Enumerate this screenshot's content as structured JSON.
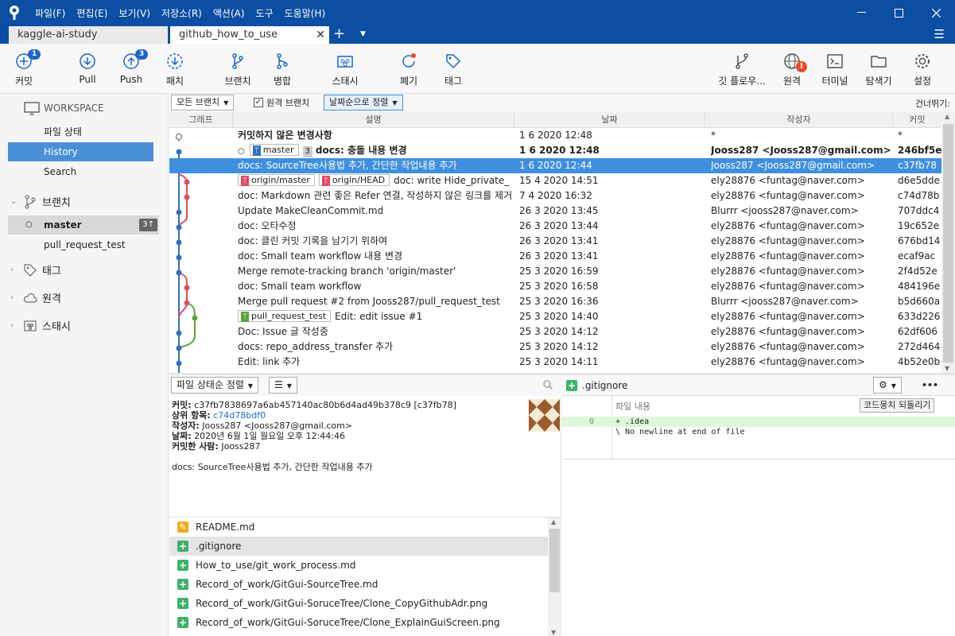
{
  "app": {
    "menus": [
      "파일(F)",
      "편집(E)",
      "보기(V)",
      "저장소(R)",
      "액션(A)",
      "도구",
      "도움말(H)"
    ]
  },
  "tabs": [
    {
      "label": "kaggle-ai-study"
    },
    {
      "label": "github_how_to_use",
      "close": "✕"
    }
  ],
  "tab_plus": "+",
  "toolbar": {
    "commit": {
      "label": "커밋",
      "badge": "1"
    },
    "pull": {
      "label": "Pull"
    },
    "push": {
      "label": "Push",
      "badge": "3"
    },
    "fetch": {
      "label": "패치"
    },
    "branch": {
      "label": "브랜치"
    },
    "merge": {
      "label": "병합"
    },
    "stash": {
      "label": "스태시"
    },
    "discard": {
      "label": "폐기"
    },
    "tag": {
      "label": "태그"
    },
    "gitflow": {
      "label": "깃 플로우..."
    },
    "remote": {
      "label": "원격",
      "alert": "!"
    },
    "terminal": {
      "label": "터미널"
    },
    "explorer": {
      "label": "탐색기"
    },
    "settings": {
      "label": "설정"
    }
  },
  "sidebar": {
    "workspace": "WORKSPACE",
    "items": [
      {
        "label": "파일 상태"
      },
      {
        "label": "History"
      },
      {
        "label": "Search"
      }
    ],
    "branches_title": "브랜치",
    "branches": [
      {
        "label": "master",
        "badge": "3↑"
      },
      {
        "label": "pull_request_test"
      }
    ],
    "tags_title": "태그",
    "remotes_title": "원격",
    "stashes_title": "스태시"
  },
  "filter": {
    "branches": "모든 브랜치",
    "remote_branches": "원격 브랜치",
    "sort": "날짜순으로 정렬",
    "jump": "건너뛰기:"
  },
  "columns": {
    "graph": "그래프",
    "desc": "설명",
    "date": "날짜",
    "author": "작성자",
    "commit": "커밋"
  },
  "commits": [
    {
      "desc": "커밋하지 않은 변경사항",
      "date": "1 6 2020 12:48",
      "author": "*",
      "hash": "*"
    },
    {
      "tag": "master",
      "count": "3",
      "desc": "docs: 충돌 내용 변경",
      "date": "1 6 2020 12:48",
      "author": "Jooss287 <Jooss287@gmail.com>",
      "hash": "246bf5e"
    },
    {
      "desc": "docs: SourceTree사용법 추가, 간단한 작업내용 추가",
      "date": "1 6 2020 12:44",
      "author": "Jooss287 <Jooss287@gmail.com>",
      "hash": "c37fb78"
    },
    {
      "tag": "origin/master",
      "tag2": "origin/HEAD",
      "desc": "doc: write Hide_private_",
      "date": "15 4 2020 14:51",
      "author": "ely28876 <funtag@naver.com>",
      "hash": "d6e5dde"
    },
    {
      "desc": "doc: Markdown 관련 좋은 Refer 연결, 작성하지 않은 링크를 제거",
      "date": "7 4 2020 16:32",
      "author": "ely28876 <funtag@naver.com>",
      "hash": "c74d78b"
    },
    {
      "desc": "Update MakeCleanCommit.md",
      "date": "26 3 2020 13:45",
      "author": "Blurrr <jooss287@naver.com>",
      "hash": "707ddc4"
    },
    {
      "desc": "doc: 오타수정",
      "date": "26 3 2020 13:44",
      "author": "ely28876 <funtag@naver.com>",
      "hash": "19c652e"
    },
    {
      "desc": "doc: 클린 커밋 기록을 남기기 위하여",
      "date": "26 3 2020 13:41",
      "author": "ely28876 <funtag@naver.com>",
      "hash": "676bd14"
    },
    {
      "desc": "doc: Small team workflow 내용 변경",
      "date": "26 3 2020 13:41",
      "author": "ely28876 <funtag@naver.com>",
      "hash": "ecaf9ac"
    },
    {
      "desc": "Merge remote-tracking branch 'origin/master'",
      "date": "25 3 2020 16:59",
      "author": "ely28876 <funtag@naver.com>",
      "hash": "2f4d52e"
    },
    {
      "desc": "doc: Small team workflow",
      "date": "25 3 2020 16:58",
      "author": "ely28876 <funtag@naver.com>",
      "hash": "484196e"
    },
    {
      "desc": "Merge pull request #2 from Jooss287/pull_request_test",
      "date": "25 3 2020 16:36",
      "author": "Blurrr <jooss287@naver.com>",
      "hash": "b5d660a"
    },
    {
      "tag": "pull_request_test",
      "desc": "Edit: edit issue #1",
      "date": "25 3 2020 14:40",
      "author": "ely28876 <funtag@naver.com>",
      "hash": "633d226"
    },
    {
      "desc": "Doc: Issue 글 작성중",
      "date": "25 3 2020 14:12",
      "author": "ely28876 <funtag@naver.com>",
      "hash": "62df606"
    },
    {
      "desc": "docs: repo_address_transfer 추가",
      "date": "25 3 2020 14:12",
      "author": "ely28876 <funtag@naver.com>",
      "hash": "272d464"
    },
    {
      "desc": "Edit: link 추가",
      "date": "25 3 2020 14:11",
      "author": "ely28876 <funtag@naver.com>",
      "hash": "4b52e0b"
    }
  ],
  "details": {
    "sort": "파일 상태순 정렬",
    "commit_label": "커밋:",
    "commit_value": "c37fb7838697a6ab457140ac80b6d4ad49b378c9 [c37fb78]",
    "parent_label": "상위 항목:",
    "parent_value": "c74d78bdf0",
    "author_label": "작성자:",
    "author_value": "Jooss287 <Jooss287@gmail.com>",
    "date_label": "날짜:",
    "date_value": "2020년 6월 1일 월요일 오후 12:44:46",
    "committer_label": "커밋한 사람:",
    "committer_value": "Jooss287",
    "message": "docs: SourceTree사용법 추가, 간단한 작업내용 추가"
  },
  "files": [
    {
      "name": "README.md",
      "status": "modified"
    },
    {
      "name": ".gitignore",
      "status": "added"
    },
    {
      "name": "How_to_use/git_work_process.md",
      "status": "added"
    },
    {
      "name": "Record_of_work/GitGui-SourceTree.md",
      "status": "added"
    },
    {
      "name": "Record_of_work/GitGui-SoruceTree/Clone_CopyGithubAdr.png",
      "status": "added"
    },
    {
      "name": "Record_of_work/GitGui-SoruceTree/Clone_ExplainGuiScreen.png",
      "status": "added"
    }
  ],
  "diff": {
    "file": ".gitignore",
    "hunk_label": "파일 내용",
    "revert_button": "코드뭉치 되돌리기",
    "more": "•••",
    "lines": [
      {
        "no": "0",
        "text": "+ .idea"
      },
      {
        "no": "",
        "text": "\\  No newline at end of file"
      }
    ]
  },
  "colors": {
    "accent": "#0b4ea2",
    "selection": "#3f8fde",
    "added": "#3fb06b",
    "modified": "#f3a91c"
  }
}
